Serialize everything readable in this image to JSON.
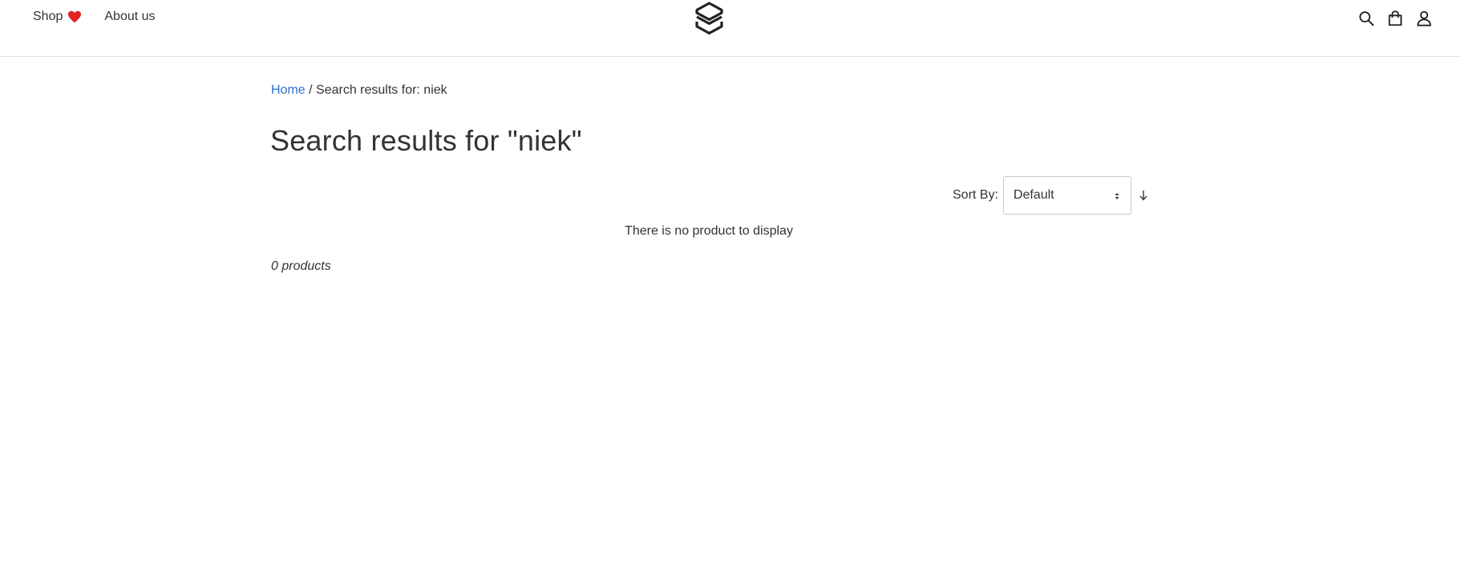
{
  "nav": {
    "shop_label": "Shop",
    "about_label": "About us"
  },
  "icons": {
    "heart": "heart-icon",
    "logo": "logo-icon",
    "search": "search-icon",
    "cart": "shopping-bag-icon",
    "user": "user-icon",
    "sort_caret": "select-caret-icon",
    "sort_direction": "arrow-down-icon"
  },
  "colors": {
    "accent_link": "#2c6ecb",
    "heart": "#e02424",
    "text": "#333333",
    "border": "#e5e5e5"
  },
  "breadcrumb": {
    "home_label": "Home",
    "separator": " / ",
    "current": "Search results for: niek"
  },
  "page": {
    "title": "Search results for \"niek\""
  },
  "sort": {
    "label": "Sort By:",
    "selected": "Default"
  },
  "results": {
    "empty_message": "There is no product to display",
    "count_text": "0 products"
  }
}
